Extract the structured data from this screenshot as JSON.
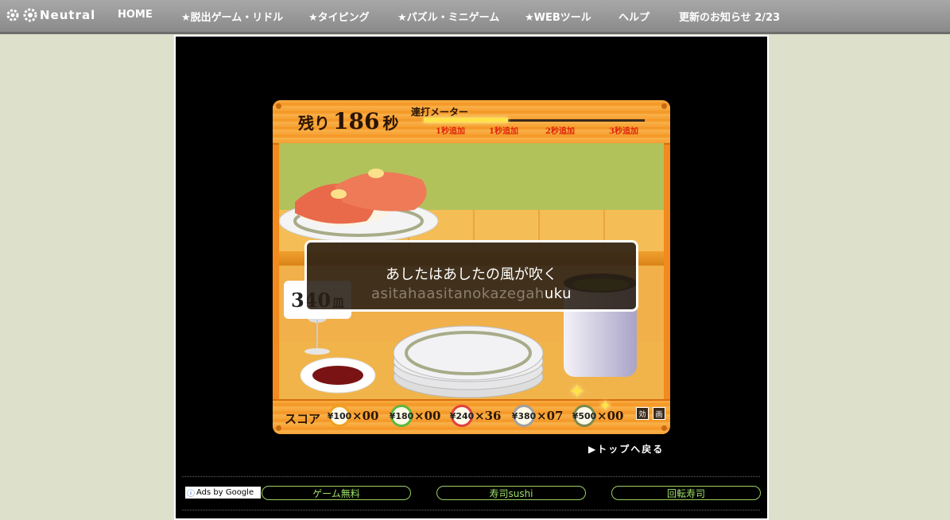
{
  "nav": {
    "logo": "Neutral",
    "items": [
      "HOME",
      "★脱出ゲーム・リドル",
      "★タイピング",
      "★パズル・ミニゲーム",
      "★WEBツール",
      "ヘルプ",
      "更新のお知らせ 2/23"
    ]
  },
  "game": {
    "time_label": "残り",
    "time_value": "186",
    "time_unit": "秒",
    "meter_label": "連打メーター",
    "meter_fill_fraction": 0.38,
    "bonuses": [
      "1秒追加",
      "1秒追加",
      "2秒追加",
      "3秒追加"
    ],
    "phrase": "あしたはあしたの風が吹く",
    "romaji_typed": "asitahaasitanokazegah",
    "romaji_remaining": "uku",
    "plates_value": "340",
    "plates_unit": "皿",
    "score_label": "スコア",
    "dishes": [
      {
        "price": "¥100",
        "count": "×00",
        "color": "#f0a020"
      },
      {
        "price": "¥180",
        "count": "×00",
        "color": "#5cb840"
      },
      {
        "price": "¥240",
        "count": "×36",
        "color": "#e04040"
      },
      {
        "price": "¥380",
        "count": "×07",
        "color": "#a0a0a0"
      },
      {
        "price": "¥500",
        "count": "×00",
        "color": "#7a8a50"
      }
    ],
    "toggle_1": "効",
    "toggle_2": "画",
    "back_link": "▶トップへ戻る"
  },
  "ads": {
    "ads_by": "Ads by Google",
    "links": [
      "ゲーム無料",
      "寿司sushi",
      "回転寿司"
    ]
  }
}
